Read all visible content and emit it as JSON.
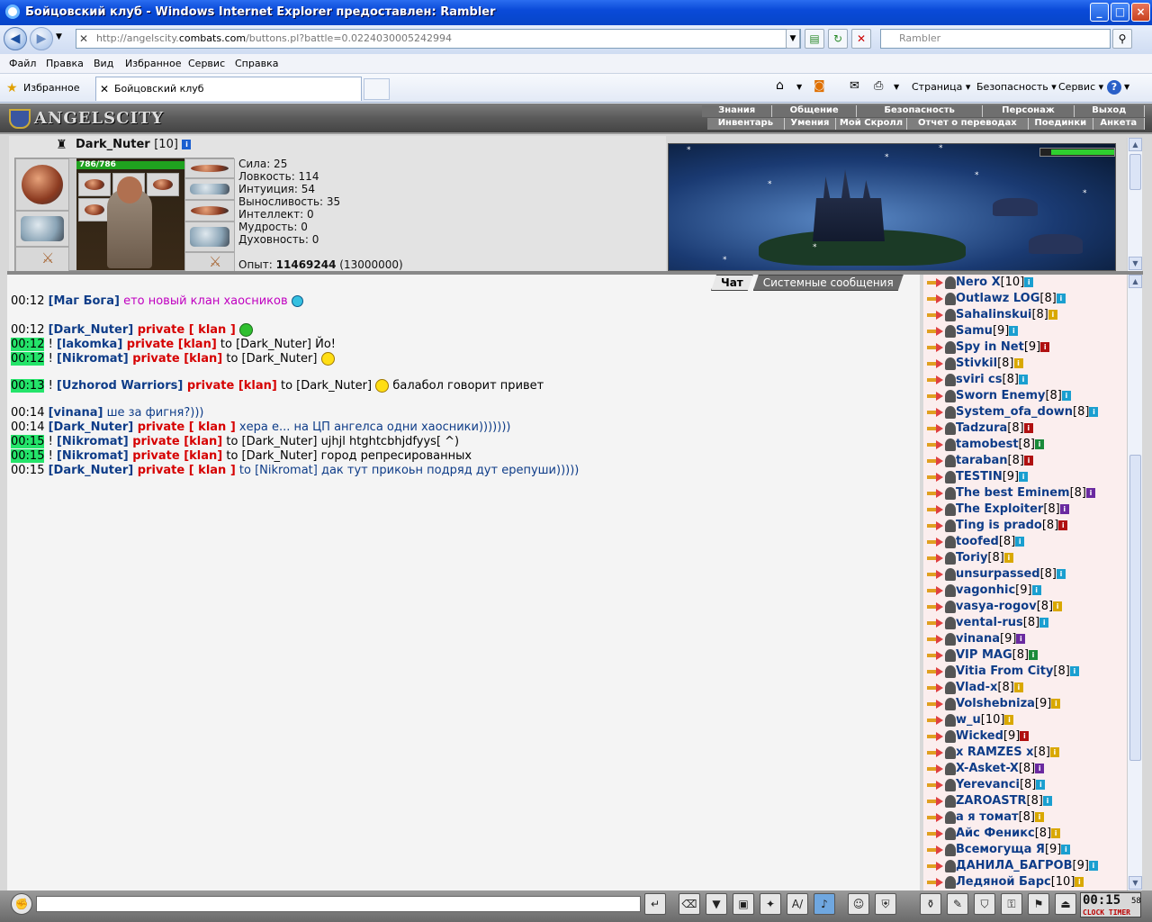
{
  "window": {
    "title": "Бойцовский клуб - Windows Internet Explorer предоставлен: Rambler"
  },
  "nav": {
    "url_prefix": "http://angelscity.",
    "url_domain": "combats.com",
    "url_suffix": "/buttons.pl?battle=0.0224030005242994",
    "search_placeholder": "Rambler"
  },
  "menu": [
    "Файл",
    "Правка",
    "Вид",
    "Избранное",
    "Сервис",
    "Справка"
  ],
  "favbar": {
    "favorites": "Избранное",
    "tab_title": "Бойцовский клуб",
    "page": "Страница",
    "safety": "Безопасность",
    "tools": "Сервис"
  },
  "game": {
    "logo": "ANGELSCITY",
    "top_nav": [
      "Знания",
      "Общение",
      "Безопасность",
      "Персонаж",
      "Выход"
    ],
    "sub_nav": [
      "Инвентарь",
      "Умения",
      "Мой Скролл",
      "Отчет о переводах",
      "Поединки",
      "Анкета"
    ],
    "character": {
      "name": "Dark_Nuter",
      "level": "[10]",
      "hp": "786/786",
      "stats": [
        "Сила: 25",
        "Ловкость: 114",
        "Интуиция: 54",
        "Выносливость: 35",
        "Интеллект: 0",
        "Мудрость: 0",
        "Духовность: 0"
      ],
      "exp_label": "Опыт:",
      "exp": "11469244",
      "exp_next": "(13000000)"
    },
    "chat_tabs": [
      "Чат",
      "Системные сообщения"
    ]
  },
  "chat": [
    {
      "time": "00:12",
      "hl": false,
      "parts": [
        [
          "nm",
          "[Маг Бога]"
        ],
        [
          "txm",
          " ето новый клан хаосников "
        ]
      ],
      "smile": "blue",
      "gap": 16
    },
    {
      "time": "00:12",
      "hl": false,
      "parts": [
        [
          "nm",
          "[Dark_Nuter]"
        ],
        [
          "pr",
          " private [ klan ] "
        ]
      ],
      "smile": "green",
      "gap": 0
    },
    {
      "time": "00:12",
      "hl": true,
      "parts": [
        [
          "tx",
          "! "
        ],
        [
          "nm",
          "[lakomka]"
        ],
        [
          "pr",
          " private [klan]"
        ],
        [
          "tx",
          " to [Dark_Nuter] Йо!"
        ]
      ],
      "smile": "",
      "gap": 0
    },
    {
      "time": "00:12",
      "hl": true,
      "parts": [
        [
          "tx",
          "! "
        ],
        [
          "nm",
          "[Nikromat]"
        ],
        [
          "pr",
          " private [klan]"
        ],
        [
          "tx",
          " to [Dark_Nuter] "
        ]
      ],
      "smile": "yellow",
      "gap": 14
    },
    {
      "time": "00:13",
      "hl": true,
      "parts": [
        [
          "tx",
          "! "
        ],
        [
          "nm",
          "[Uzhorod Warriors]"
        ],
        [
          "pr",
          " private [klan]"
        ],
        [
          "tx",
          " to [Dark_Nuter] "
        ]
      ],
      "smile": "yellow",
      "after": " балабол говорит привет",
      "gap": 14
    },
    {
      "time": "00:14",
      "hl": false,
      "parts": [
        [
          "nm",
          "[vinana]"
        ],
        [
          "txb",
          " ше за фигня?)))"
        ]
      ],
      "smile": "",
      "gap": 0
    },
    {
      "time": "00:14",
      "hl": false,
      "parts": [
        [
          "nm",
          "[Dark_Nuter]"
        ],
        [
          "pr",
          " private [ klan ]"
        ],
        [
          "txb",
          " хера е... на ЦП ангелса одни хаосники)))))))"
        ]
      ],
      "smile": "",
      "gap": 0
    },
    {
      "time": "00:15",
      "hl": true,
      "parts": [
        [
          "tx",
          "! "
        ],
        [
          "nm",
          "[Nikromat]"
        ],
        [
          "pr",
          " private [klan]"
        ],
        [
          "tx",
          " to [Dark_Nuter] ujhjl htghtcbhjdfyys[ ^)"
        ]
      ],
      "smile": "",
      "gap": 0
    },
    {
      "time": "00:15",
      "hl": true,
      "parts": [
        [
          "tx",
          "! "
        ],
        [
          "nm",
          "[Nikromat]"
        ],
        [
          "pr",
          " private [klan]"
        ],
        [
          "tx",
          " to [Dark_Nuter] город репресированных"
        ]
      ],
      "smile": "",
      "gap": 0
    },
    {
      "time": "00:15",
      "hl": false,
      "parts": [
        [
          "nm",
          "[Dark_Nuter]"
        ],
        [
          "pr",
          " private [ klan ]"
        ],
        [
          "txb",
          " to [Nikromat] дак тут прикоьн подряд дут ерепуши)))))"
        ]
      ],
      "smile": "",
      "gap": 0
    }
  ],
  "users": [
    {
      "name": "Nero X",
      "lvl": "[10]",
      "c": "#1a9fd0"
    },
    {
      "name": "Outlawz LOG",
      "lvl": "[8]",
      "c": "#1a9fd0"
    },
    {
      "name": "Sahalinskui",
      "lvl": "[8]",
      "c": "#d9a800"
    },
    {
      "name": "Samu",
      "lvl": "[9]",
      "c": "#1a9fd0"
    },
    {
      "name": "Spy in Net",
      "lvl": "[9]",
      "c": "#b01010"
    },
    {
      "name": "Stivkil",
      "lvl": "[8]",
      "c": "#d9a800"
    },
    {
      "name": "sviri cs",
      "lvl": "[8]",
      "c": "#1a9fd0"
    },
    {
      "name": "Sworn Enemy",
      "lvl": "[8]",
      "c": "#1a9fd0"
    },
    {
      "name": "System_ofa_down",
      "lvl": "[8]",
      "c": "#1a9fd0"
    },
    {
      "name": "Tadzura",
      "lvl": "[8]",
      "c": "#b01010"
    },
    {
      "name": "tamobest",
      "lvl": "[8]",
      "c": "#1a8a3a"
    },
    {
      "name": "taraban",
      "lvl": "[8]",
      "c": "#b01010"
    },
    {
      "name": "TESTIN",
      "lvl": "[9]",
      "c": "#1a9fd0"
    },
    {
      "name": "The best Eminem",
      "lvl": "[8]",
      "c": "#6a2aa0"
    },
    {
      "name": "The Exploiter",
      "lvl": "[8]",
      "c": "#6a2aa0"
    },
    {
      "name": "Ting is prado",
      "lvl": "[8]",
      "c": "#b01010"
    },
    {
      "name": "toofed",
      "lvl": "[8]",
      "c": "#1a9fd0"
    },
    {
      "name": "Toriy",
      "lvl": "[8]",
      "c": "#d9a800"
    },
    {
      "name": "unsurpassed",
      "lvl": "[8]",
      "c": "#1a9fd0"
    },
    {
      "name": "vagonhic",
      "lvl": "[9]",
      "c": "#1a9fd0"
    },
    {
      "name": "vasya-rogov",
      "lvl": "[8]",
      "c": "#d9a800"
    },
    {
      "name": "vental-rus",
      "lvl": "[8]",
      "c": "#1a9fd0"
    },
    {
      "name": "vinana",
      "lvl": "[9]",
      "c": "#6a2aa0"
    },
    {
      "name": "VIP MAG",
      "lvl": "[8]",
      "c": "#1a8a3a"
    },
    {
      "name": "Vitia From City",
      "lvl": "[8]",
      "c": "#1a9fd0"
    },
    {
      "name": "Vlad-x",
      "lvl": "[8]",
      "c": "#d9a800"
    },
    {
      "name": "Volshebniza",
      "lvl": "[9]",
      "c": "#d9a800"
    },
    {
      "name": "w_u",
      "lvl": "[10]",
      "c": "#d9a800"
    },
    {
      "name": "Wicked",
      "lvl": "[9]",
      "c": "#b01010"
    },
    {
      "name": "x RAMZES x",
      "lvl": "[8]",
      "c": "#d9a800"
    },
    {
      "name": "X-Asket-X",
      "lvl": "[8]",
      "c": "#6a2aa0"
    },
    {
      "name": "Yerevanci",
      "lvl": "[8]",
      "c": "#1a9fd0"
    },
    {
      "name": "ZAROASTR",
      "lvl": "[8]",
      "c": "#1a9fd0"
    },
    {
      "name": "а я томат",
      "lvl": "[8]",
      "c": "#d9a800"
    },
    {
      "name": "Айс Феникс",
      "lvl": "[8]",
      "c": "#d9a800"
    },
    {
      "name": "Всемогуща Я",
      "lvl": "[9]",
      "c": "#1a9fd0"
    },
    {
      "name": "ДАНИЛА_БАГРОВ",
      "lvl": "[9]",
      "c": "#1a9fd0"
    },
    {
      "name": "Ледяной Барс",
      "lvl": "[10]",
      "c": "#d9a800"
    }
  ],
  "clock": {
    "time": "00:15",
    "sec": "58",
    "label": "CLOCK TIMER"
  },
  "colors": {
    "accent": "#0e3c88",
    "private": "#d60000",
    "highlight": "#24e46a"
  }
}
